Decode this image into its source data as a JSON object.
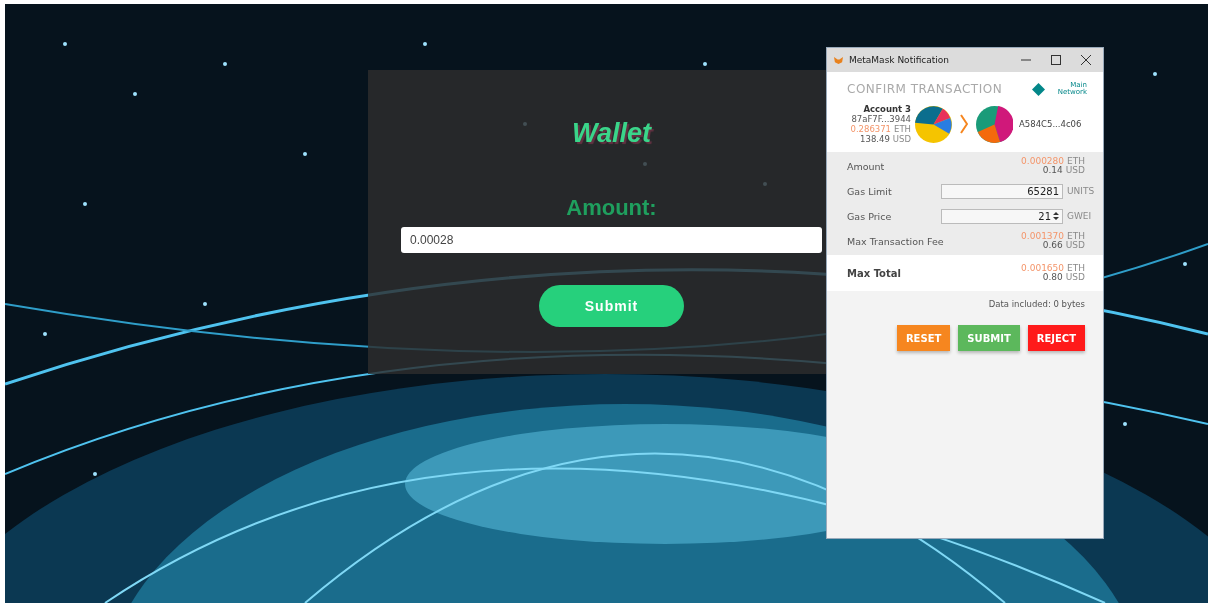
{
  "wallet": {
    "title": "Wallet",
    "amount_label": "Amount:",
    "amount_value": "0.00028",
    "submit": "Submit"
  },
  "popup": {
    "title": "MetaMask Notification",
    "heading": "CONFIRM TRANSACTION",
    "network": "Main Network",
    "sender": {
      "name": "Account 3",
      "address": "87aF7F...3944",
      "balance": "0.286371",
      "balance_unit": "ETH",
      "fiat": "138.49",
      "fiat_unit": "USD"
    },
    "recipient": {
      "address": "A584C5...4c06"
    },
    "details": [
      {
        "kind": "value",
        "label": "Amount",
        "eth": "0.000280",
        "eth_unit": "ETH",
        "usd": "0.14",
        "usd_unit": "USD"
      },
      {
        "kind": "input",
        "label": "Gas Limit",
        "value": "65281",
        "unit": "UNITS"
      },
      {
        "kind": "spinner",
        "label": "Gas Price",
        "value": "21",
        "unit": "GWEI"
      },
      {
        "kind": "value",
        "label": "Max Transaction Fee",
        "eth": "0.001370",
        "eth_unit": "ETH",
        "usd": "0.66",
        "usd_unit": "USD"
      }
    ],
    "total": {
      "label": "Max Total",
      "eth": "0.001650",
      "eth_unit": "ETH",
      "usd": "0.80",
      "usd_unit": "USD"
    },
    "data_note": "Data included: 0 bytes",
    "buttons": [
      {
        "label": "RESET",
        "color": "#f6861f"
      },
      {
        "label": "SUBMIT",
        "color": "#5cb85c"
      },
      {
        "label": "REJECT",
        "color": "#ff1a1a"
      }
    ]
  }
}
